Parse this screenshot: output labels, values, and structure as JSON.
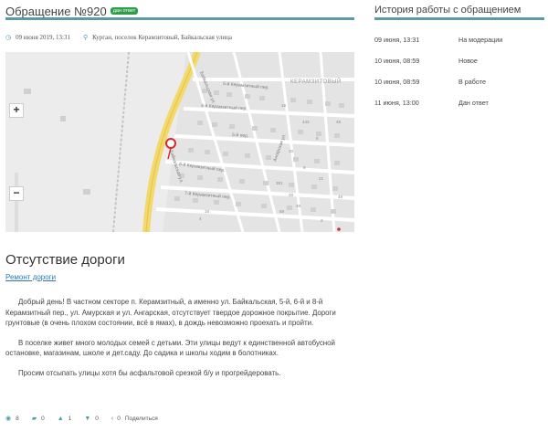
{
  "request": {
    "title": "Обращение №920",
    "badge": "дан ответ",
    "date": "09 июня 2019, 13:31",
    "address": "Курган, поселок Керамзитовый, Байкальская улица"
  },
  "map": {
    "district_label": "КЕРАМЗИТОВЫЙ",
    "street_labels": [
      "Байкальская ул.",
      "5-й Керамзитный пер.",
      "4-й Керамзитный пер.",
      "5-й пер.",
      "Ангарская ул.",
      "Байкальская ул.",
      "6-й Керамзитный пер.",
      "7-й Керамзитный пер."
    ],
    "house_numbers": [
      "18",
      "443",
      "48",
      "9",
      "10",
      "9",
      "21",
      "381",
      "20",
      "48",
      "59",
      "16",
      "4",
      "2",
      "49"
    ],
    "zoom_in": "+",
    "zoom_out": "−",
    "icons": {
      "marker": "map-pin-icon"
    }
  },
  "article": {
    "heading": "Отсутствие дороги",
    "category": "Ремонт дороги",
    "paragraphs": [
      "Добрый день! В частном секторе п. Керамзитный, а именно ул. Байкальская, 5-й, 6-й и 8-й Керамзитный пер., ул. Амурская и ул. Ангарская, отсутствует твердое дорожное покрытие. Дороги грунтовые (в очень плохом состоянии, всё в ямах), в дождь невозможно проехать и пройти.",
      "В поселке живет много молодых семей с детьми. Эти улицы ведут к единственной автобусной остановке, магазинам, школе и дет.саду. До садика и школы ходим в болотниках.",
      "Просим отсыпать улицы хотя бы асфальтовой срезкой б/у и прогрейдеровать."
    ]
  },
  "stats": {
    "views": "8",
    "comments": "0",
    "likes": "1",
    "dislikes": "0",
    "share_count": "0",
    "share_label": "Поделиться"
  },
  "history": {
    "title": "История работы с обращением",
    "entries": [
      {
        "date": "09 июня, 13:31",
        "status": "На модерации"
      },
      {
        "date": "10 июня, 08:59",
        "status": "Новое"
      },
      {
        "date": "10 июня, 08:59",
        "status": "В работе"
      },
      {
        "date": "11 июня, 13:00",
        "status": "Дан ответ"
      }
    ]
  },
  "colors": {
    "accent": "#5a9ba6",
    "badge": "#2e9d4a",
    "link": "#2a7ab0"
  }
}
